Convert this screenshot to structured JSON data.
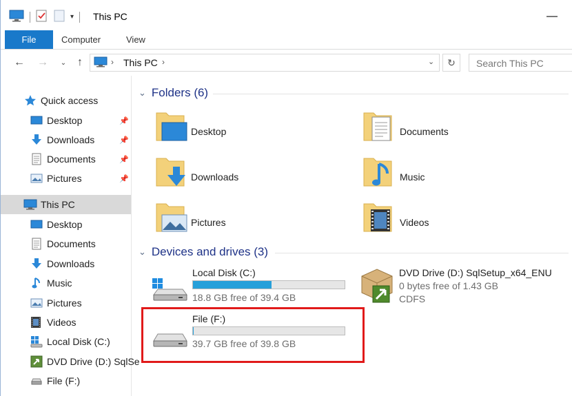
{
  "window": {
    "title": "This PC"
  },
  "ribbon": {
    "tabs": [
      "File",
      "Computer",
      "View"
    ]
  },
  "address": {
    "path_root": "This PC",
    "search_placeholder": "Search This PC"
  },
  "nav": {
    "quick_access": "Quick access",
    "qa_items": [
      "Desktop",
      "Downloads",
      "Documents",
      "Pictures"
    ],
    "this_pc": "This PC",
    "pc_items": [
      "Desktop",
      "Documents",
      "Downloads",
      "Music",
      "Pictures",
      "Videos",
      "Local Disk (C:)",
      "DVD Drive (D:) SqlSe",
      "File (F:)"
    ]
  },
  "folders": {
    "header": "Folders (6)",
    "items": [
      "Desktop",
      "Documents",
      "Downloads",
      "Music",
      "Pictures",
      "Videos"
    ]
  },
  "devices": {
    "header": "Devices and drives (3)",
    "drives": [
      {
        "name": "Local Disk (C:)",
        "free_text": "18.8 GB free of 39.4 GB",
        "used_fraction": 0.52
      },
      {
        "name": "DVD Drive (D:) SqlSetup_x64_ENU",
        "free_text": "0 bytes free of 1.43 GB",
        "fs": "CDFS"
      },
      {
        "name": "File (F:)",
        "free_text": "39.7 GB free of 39.8 GB",
        "used_fraction": 0.003
      }
    ]
  },
  "colors": {
    "accent": "#1979ca",
    "bar_fill": "#26a0da",
    "highlight": "#e11a1a",
    "group_header": "#1e3287"
  }
}
